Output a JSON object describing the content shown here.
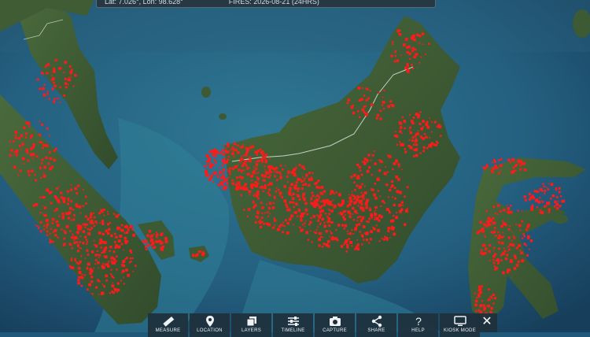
{
  "status": {
    "coords": "Lat: 7.026°, Lon: 98.628°",
    "fires": "FIRES: 2026-08-21 (24HRS)"
  },
  "toolbar": [
    {
      "label": "MEASURE",
      "icon": "ruler-icon"
    },
    {
      "label": "LOCATION",
      "icon": "location-pin-icon"
    },
    {
      "label": "LAYERS",
      "icon": "layers-icon"
    },
    {
      "label": "TIMELINE",
      "icon": "sliders-icon"
    },
    {
      "label": "CAPTURE",
      "icon": "camera-icon"
    },
    {
      "label": "SHARE",
      "icon": "share-icon"
    },
    {
      "label": "HELP",
      "icon": "help-icon"
    },
    {
      "label": "KIOSK MODE",
      "icon": "monitor-icon"
    }
  ],
  "close_icon": "close-icon",
  "colors": {
    "ocean": "#1f5878",
    "shelf": "#2e7a96",
    "land": "#3d5b34",
    "fire": "#ff1a1a",
    "toolbar_bg": "#1e303c"
  }
}
